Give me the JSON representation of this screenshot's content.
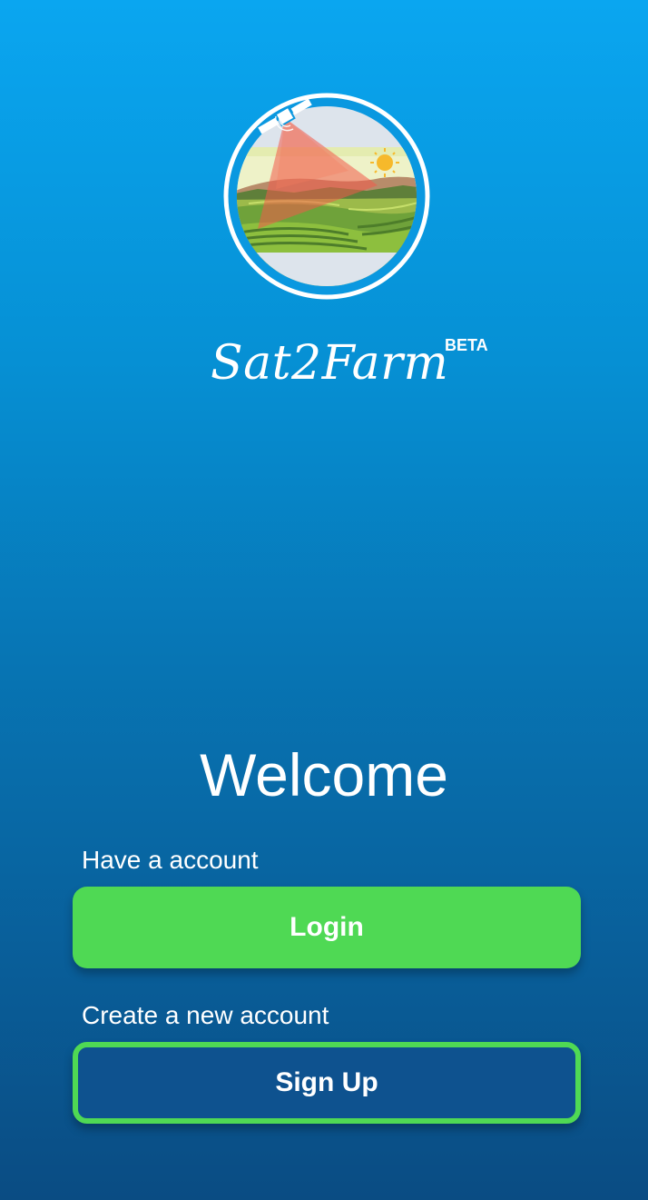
{
  "app": {
    "name": "Sat2Farm",
    "badge": "BETA"
  },
  "welcome": {
    "heading": "Welcome",
    "login_prompt": "Have a account",
    "login_label": "Login",
    "signup_prompt": "Create a new account",
    "signup_label": "Sign Up"
  },
  "colors": {
    "background_top": "#0aa6f0",
    "background_bottom": "#0a4c83",
    "accent_green": "#4fd954",
    "signup_fill": "#0e528f"
  },
  "icons": {
    "logo": "satellite-farm-logo-icon"
  }
}
